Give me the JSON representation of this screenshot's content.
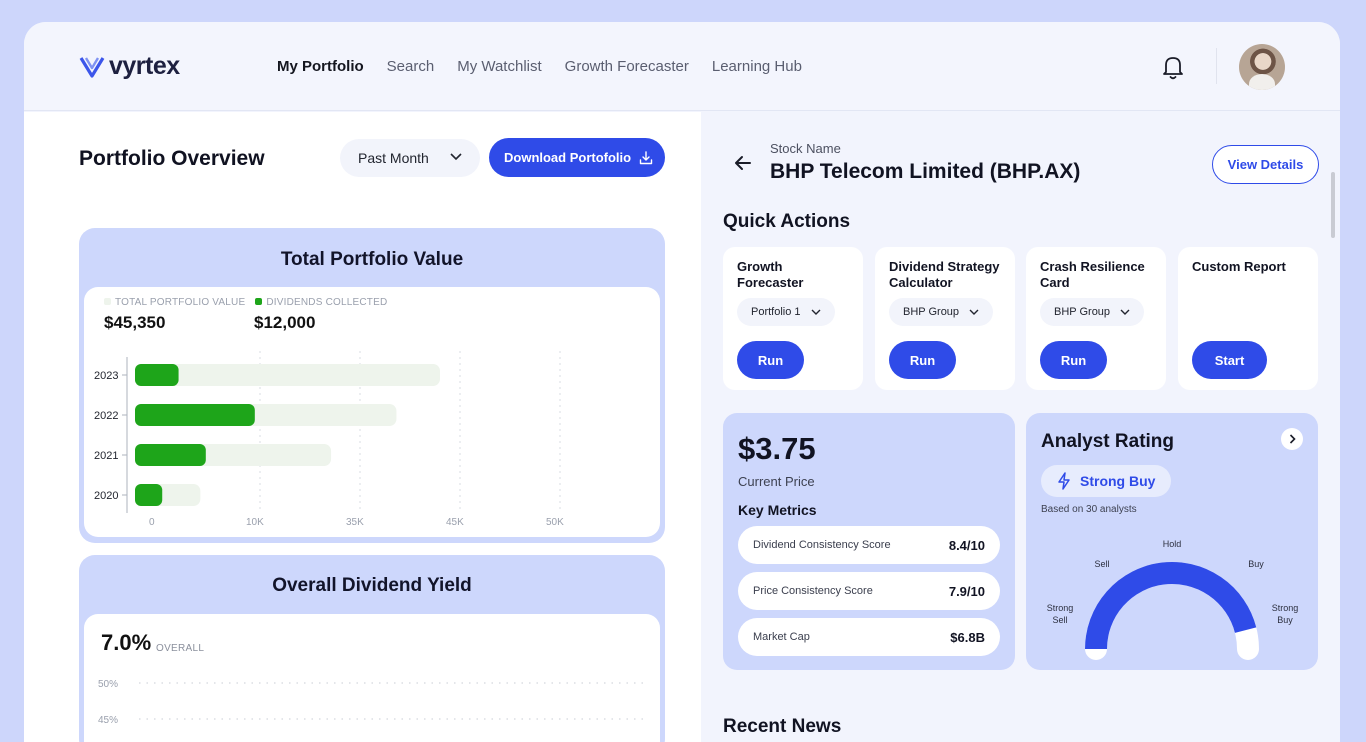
{
  "brand": {
    "name": "vyrtex"
  },
  "nav": {
    "items": [
      "My Portfolio",
      "Search",
      "My Watchlist",
      "Growth Forecaster",
      "Learning Hub"
    ],
    "active_index": 0
  },
  "portfolio": {
    "title": "Portfolio Overview",
    "period": "Past Month",
    "download_label": "Download Portofolio"
  },
  "total_value": {
    "title": "Total Portfolio Value",
    "legend": [
      {
        "label": "TOTAL PORTFOLIO VALUE",
        "color": "#eef4ec"
      },
      {
        "label": "DIVIDENDS COLLECTED",
        "color": "#1ea51a"
      }
    ],
    "total_value": "$45,350",
    "dividends": "$12,000"
  },
  "dividend_yield": {
    "title": "Overall Dividend Yield",
    "value": "7.0%",
    "label": "OVERALL"
  },
  "stock": {
    "label": "Stock Name",
    "name": "BHP Telecom Limited (BHP.AX)",
    "view_label": "View Details"
  },
  "quick_actions": {
    "title": "Quick Actions",
    "cards": [
      {
        "name_lines": [
          "Growth",
          "Forecaster"
        ],
        "select": "Portfolio 1",
        "button": "Run"
      },
      {
        "name_lines": [
          "Dividend Strategy",
          "Calculator"
        ],
        "select": "BHP Group",
        "button": "Run"
      },
      {
        "name_lines": [
          "Crash Resilience",
          "Card"
        ],
        "select": "BHP Group",
        "button": "Run"
      },
      {
        "name_lines": [
          "Custom Report"
        ],
        "select": null,
        "button": "Start"
      }
    ]
  },
  "price": {
    "value": "$3.75",
    "label": "Current Price",
    "metrics_title": "Key Metrics",
    "metrics": [
      {
        "label": "Dividend Consistency Score",
        "value": "8.4/10"
      },
      {
        "label": "Price Consistency Score",
        "value": "7.9/10"
      },
      {
        "label": "Market Cap",
        "value": "$6.8B"
      }
    ]
  },
  "analyst": {
    "title": "Analyst Rating",
    "rating": "Strong Buy",
    "based_on": "Based on 30 analysts",
    "gauge_labels": {
      "strong_sell": [
        "Strong",
        "Sell"
      ],
      "sell": "Sell",
      "hold": "Hold",
      "buy": "Buy",
      "strong_buy": [
        "Strong",
        "Buy"
      ]
    },
    "gauge_fraction": 0.92
  },
  "news": {
    "title": "Recent News"
  },
  "colors": {
    "accent": "#2f4be8",
    "dividend_green": "#1ea51a",
    "card_blue": "#cdd7fc"
  },
  "chart_data": [
    {
      "type": "bar",
      "orientation": "horizontal",
      "categories": [
        "2023",
        "2022",
        "2021",
        "2020"
      ],
      "series": [
        {
          "name": "TOTAL PORTFOLIO VALUE",
          "values": [
            28000,
            24000,
            18000,
            6000
          ]
        },
        {
          "name": "DIVIDENDS COLLECTED",
          "values": [
            4000,
            11000,
            6500,
            2500
          ]
        }
      ],
      "x_ticks": [
        "0",
        "10K",
        "35K",
        "45K",
        "50K"
      ],
      "grid": true
    },
    {
      "type": "line",
      "y_ticks": [
        "50%",
        "45%"
      ],
      "series": []
    }
  ]
}
